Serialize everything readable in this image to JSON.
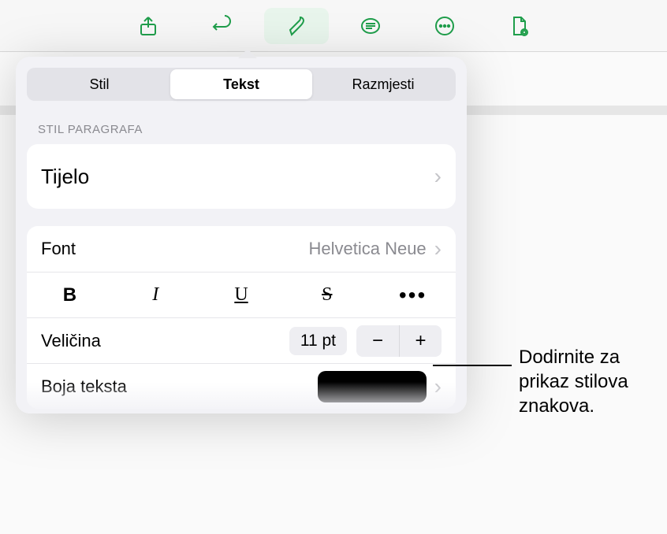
{
  "toolbar": {
    "icons": [
      "share",
      "undo",
      "format-brush",
      "layout",
      "more",
      "reader"
    ]
  },
  "tabs": {
    "style": "Stil",
    "text": "Tekst",
    "arrange": "Razmjesti",
    "selected": "text"
  },
  "sectionLabel": "STIL PARAGRAFA",
  "paragraphStyle": {
    "name": "Tijelo"
  },
  "font": {
    "label": "Font",
    "value": "Helvetica Neue"
  },
  "styleButtons": {
    "bold": "B",
    "italic": "I",
    "underline": "U",
    "strike": "S",
    "more": "•••"
  },
  "size": {
    "label": "Veličina",
    "value": "11 pt",
    "minus": "−",
    "plus": "+"
  },
  "textColor": {
    "label": "Boja teksta",
    "value": "#000000"
  },
  "callout": "Dodirnite za prikaz stilova znakova.",
  "chevron": "›"
}
